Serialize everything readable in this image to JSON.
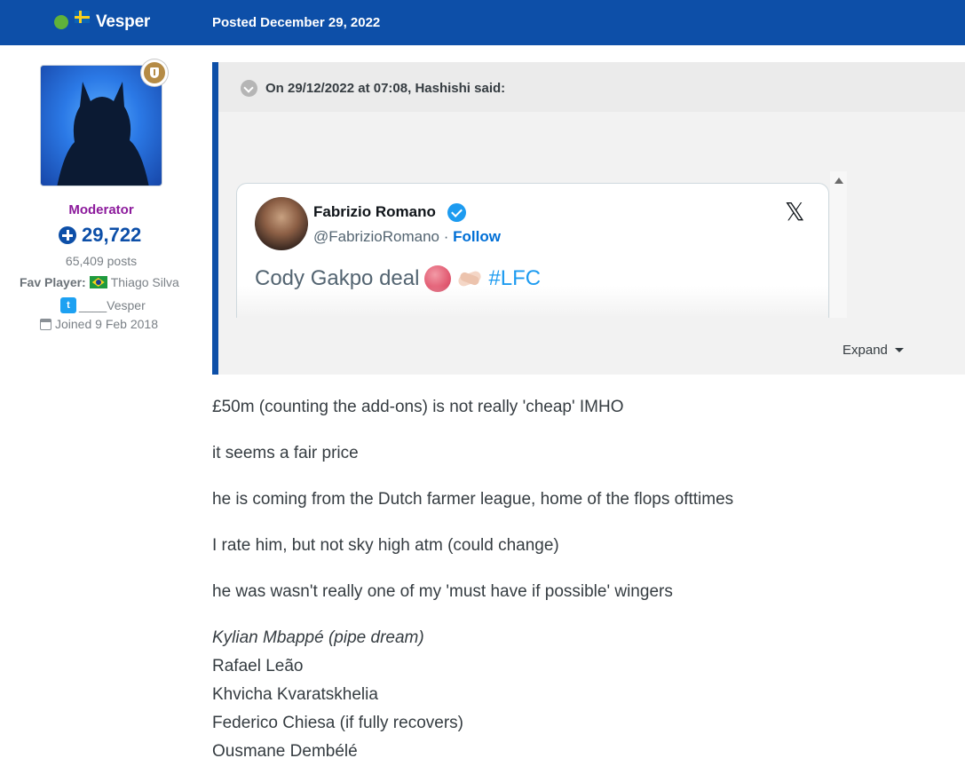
{
  "header": {
    "author_name": "Vesper",
    "posted": "Posted December 29, 2022"
  },
  "author": {
    "role": "Moderator",
    "reputation": "29,722",
    "posts": "65,409 posts",
    "fav_label": "Fav Player:",
    "fav_player": "Thiago Silva",
    "twitter_handle": "____Vesper",
    "joined": "Joined 9 Feb 2018"
  },
  "quote": {
    "citation": "On 29/12/2022 at 07:08, Hashishi said:",
    "expand_label": "Expand",
    "tweet": {
      "name": "Fabrizio Romano",
      "handle": "@FabrizioRomano",
      "separator": "·",
      "follow": "Follow",
      "text": "Cody Gakpo deal",
      "hashtag": "#LFC",
      "x_logo": "𝕏"
    }
  },
  "body": {
    "paragraphs": [
      "£50m (counting the add-ons) is not really 'cheap' IMHO",
      "it seems a fair price",
      "he is coming from the Dutch farmer league, home of the flops ofttimes",
      "I rate him, but not sky high atm (could change)",
      "he was wasn't really one of my 'must have if possible' wingers"
    ],
    "wingers": [
      "Kylian Mbappé (pipe dream)",
      "Rafael Leão",
      "Khvicha Kvaratskhelia",
      "Federico Chiesa (if fully recovers)",
      "Ousmane Dembélé"
    ]
  },
  "colors": {
    "header_blue": "#0d4fa8",
    "moderator_purple": "#8c1a9c",
    "online_green": "#60b23a",
    "link_blue": "#006fd6"
  },
  "icons": [
    "online-dot-icon",
    "sweden-flag-icon",
    "moderator-badge-icon",
    "reputation-plus-icon",
    "brazil-flag-icon",
    "twitter-icon",
    "calendar-icon",
    "quote-toggle-icon",
    "verified-icon",
    "x-logo-icon",
    "heart-icon",
    "handshake-icon",
    "caret-down-icon",
    "scroll-up-icon"
  ]
}
